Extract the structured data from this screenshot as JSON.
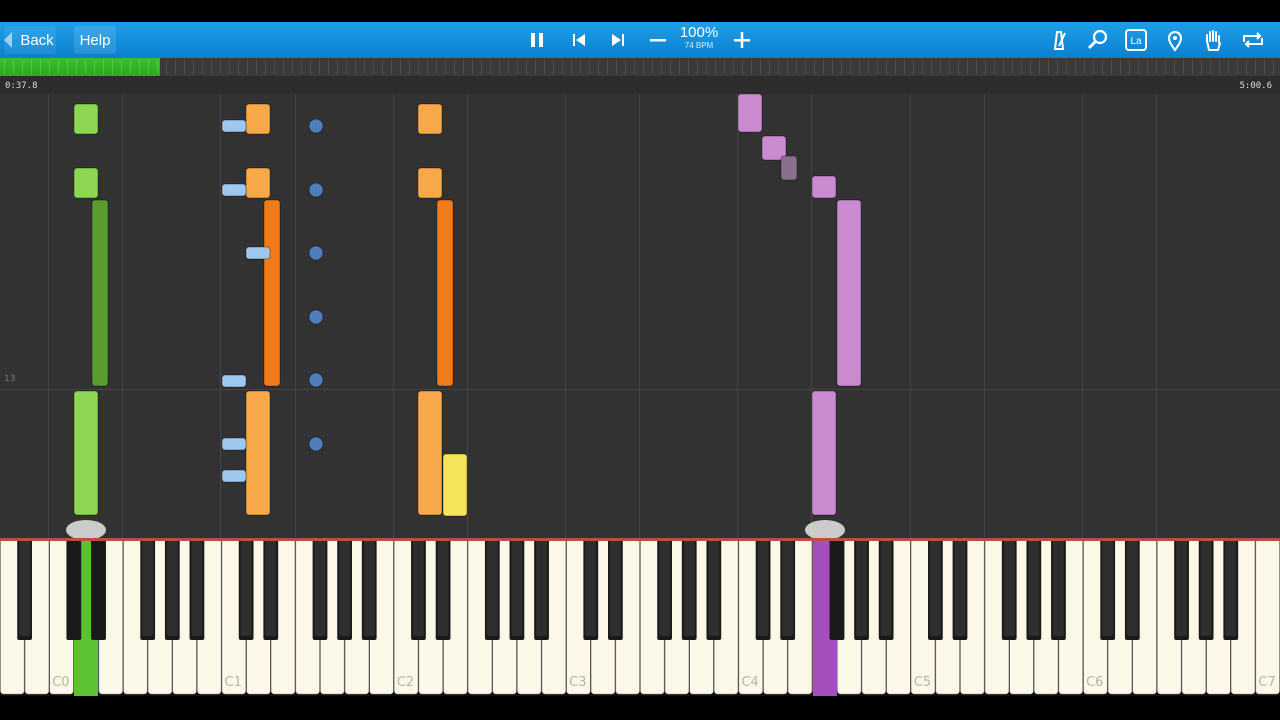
{
  "toolbar": {
    "back_label": "Back",
    "help_label": "Help",
    "speed_percent": "100%",
    "tempo": "74 BPM",
    "icons": [
      "pause-icon",
      "skip-back-icon",
      "skip-forward-icon",
      "minus-icon",
      "plus-icon",
      "metronome-icon",
      "magnifier-icon",
      "note-label-icon",
      "location-pin-icon",
      "hand-icon",
      "loop-icon"
    ],
    "note_label_icon_text": "La"
  },
  "timeline": {
    "current_time": "0:37.8",
    "end_time": "5:00.6",
    "progress_fraction": 0.125
  },
  "roll": {
    "measure_number": "13"
  },
  "keyboard": {
    "octave_labels": [
      "C0",
      "C1",
      "C2",
      "C3",
      "C4",
      "C5",
      "C6",
      "C7"
    ],
    "pressed_keys": [
      "C#0",
      "C#4"
    ]
  },
  "colors": {
    "toolbar": "#1296df",
    "progress": "#2eb01f",
    "green_note": "#8ed651",
    "orange_note": "#f7a94a",
    "blue_note": "#9fc6ec",
    "purple_note": "#c98ad0",
    "yellow_note": "#f5e35a",
    "background": "#323232"
  }
}
